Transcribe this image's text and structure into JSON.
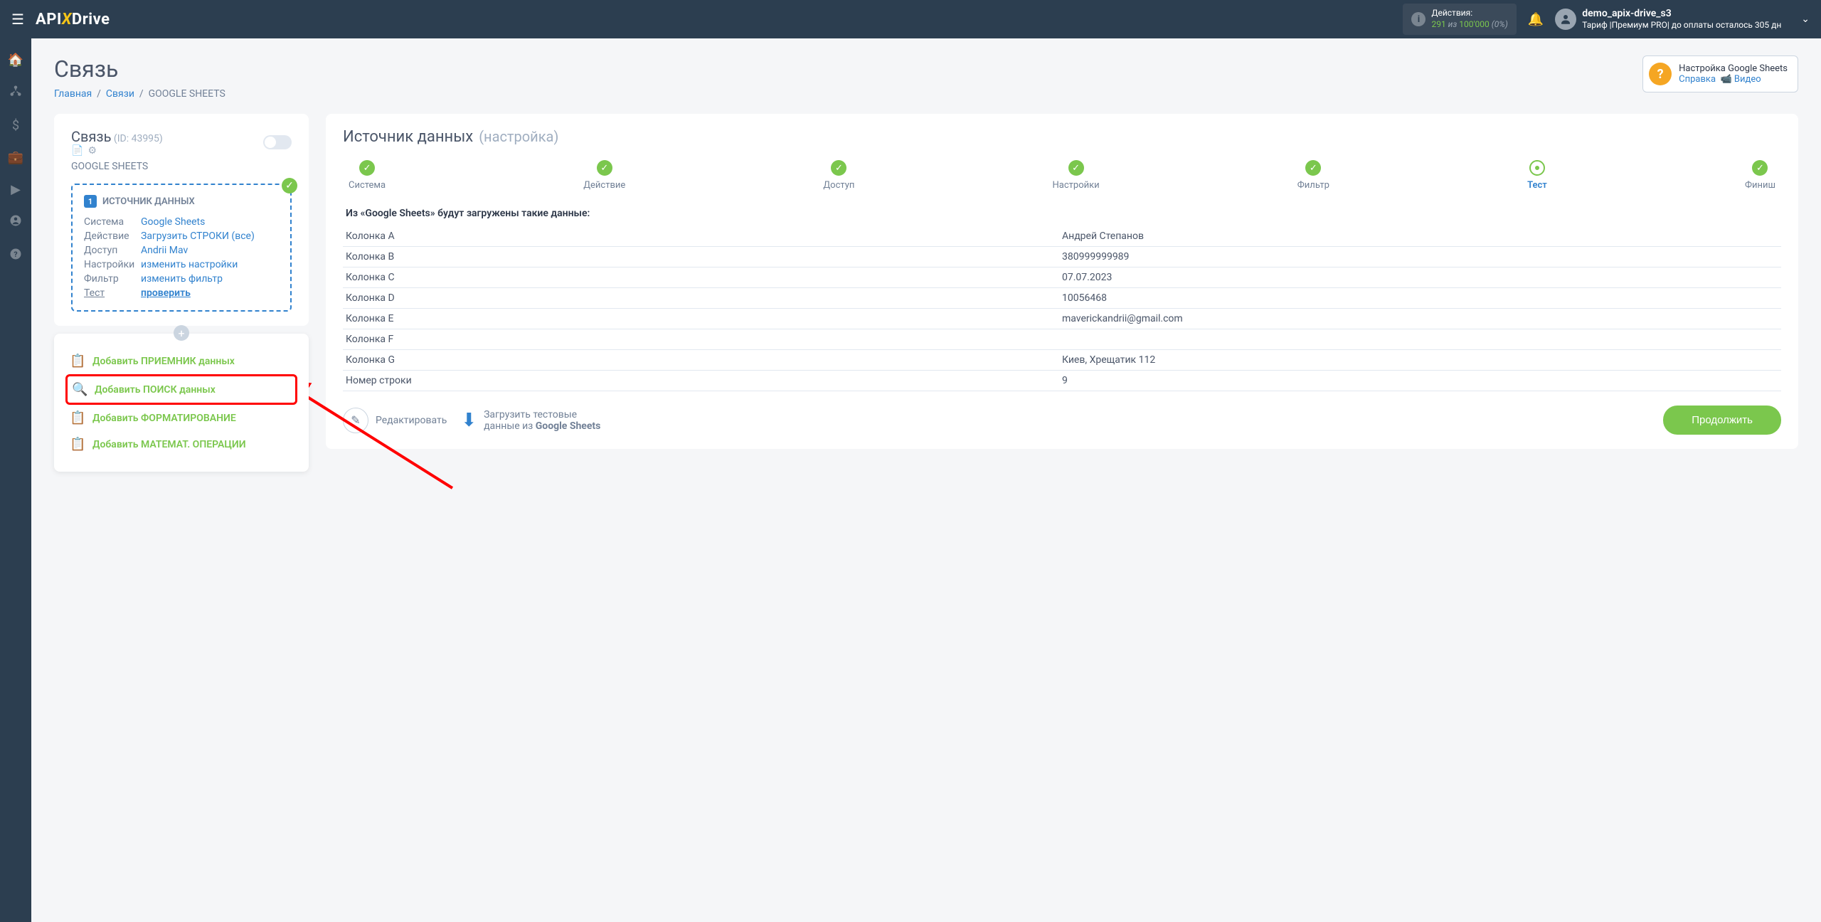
{
  "topbar": {
    "logo_pre": "API",
    "logo_x": "X",
    "logo_post": "Drive",
    "actions_label": "Действия:",
    "actions_used": "291",
    "actions_sep": " из ",
    "actions_total": "100'000",
    "actions_pct": " (0%)",
    "user_name": "demo_apix-drive_s3",
    "user_plan": "Тариф |Премиум PRO| до оплаты осталось 305 дн"
  },
  "page": {
    "title": "Связь",
    "bc_home": "Главная",
    "bc_links": "Связи",
    "bc_current": "GOOGLE SHEETS"
  },
  "help": {
    "title": "Настройка Google Sheets",
    "link1": "Справка",
    "link2": "Видео",
    "cam": "📹 "
  },
  "conn": {
    "title": "Связь",
    "id_label": " (ID: 43995) ",
    "sub": "GOOGLE SHEETS",
    "source_title": "ИСТОЧНИК ДАННЫХ",
    "rows": [
      {
        "k": "Система",
        "v": "Google Sheets"
      },
      {
        "k": "Действие",
        "v": "Загрузить СТРОКИ (все)"
      },
      {
        "k": "Доступ",
        "v": "Andrii Mav"
      },
      {
        "k": "Настройки",
        "v": "изменить настройки"
      },
      {
        "k": "Фильтр",
        "v": "изменить фильтр"
      },
      {
        "k": "Тест",
        "v": "проверить"
      }
    ]
  },
  "add_actions": [
    "Добавить ПРИЕМНИК данных",
    "Добавить ПОИСК данных",
    "Добавить ФОРМАТИРОВАНИЕ",
    "Добавить МАТЕМАТ. ОПЕРАЦИИ"
  ],
  "right": {
    "title": "Источник данных",
    "subtitle": "(настройка)",
    "steps": [
      "Система",
      "Действие",
      "Доступ",
      "Настройки",
      "Фильтр",
      "Тест",
      "Финиш"
    ],
    "intro": "Из «Google Sheets» будут загружены такие данные:",
    "data_rows": [
      [
        "Колонка A",
        "Андрей Степанов"
      ],
      [
        "Колонка B",
        "380999999989"
      ],
      [
        "Колонка C",
        "07.07.2023"
      ],
      [
        "Колонка D",
        "10056468"
      ],
      [
        "Колонка E",
        "maverickandrii@gmail.com"
      ],
      [
        "Колонка F",
        ""
      ],
      [
        "Колонка G",
        "Киев, Хрещатик 112"
      ],
      [
        "Номер строки",
        "9"
      ]
    ],
    "edit": "Редактировать",
    "load_l1": "Загрузить тестовые",
    "load_l2_a": "данные из ",
    "load_l2_b": "Google Sheets",
    "continue": "Продолжить"
  }
}
